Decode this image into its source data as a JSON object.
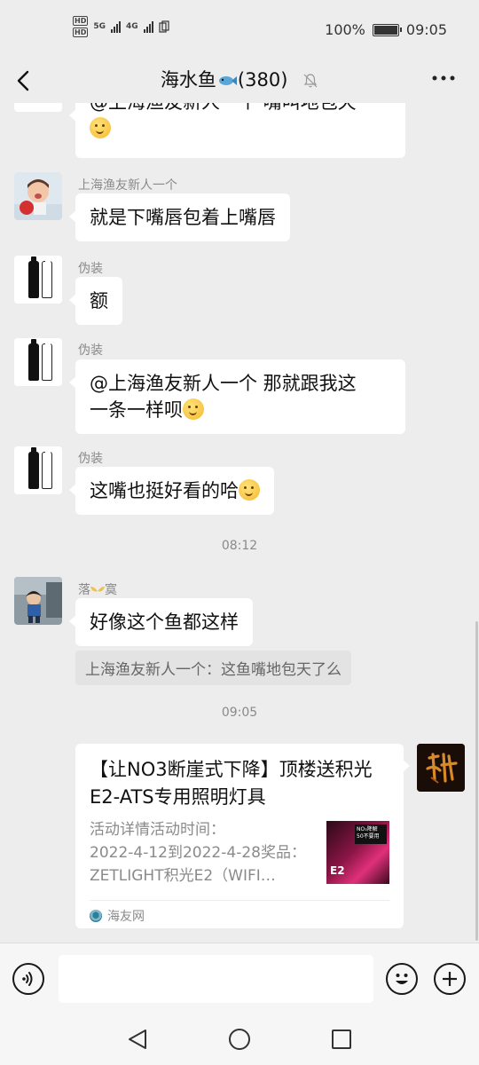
{
  "status_bar": {
    "network_left": "HD",
    "network_left_2": "HD",
    "signal_5g": "5G",
    "signal_4g": "4G",
    "battery_percent": "100%",
    "time": "09:05"
  },
  "header": {
    "title_prefix": "海水鱼",
    "title_count": "(380)",
    "back_icon": "chevron-left-icon",
    "mute_icon": "bell-off-icon",
    "more_icon": "more-icon"
  },
  "messages": [
    {
      "id": "m0",
      "sender": "",
      "text": "@上海渔友新人一个  嘴叫地包天",
      "partial": true
    },
    {
      "id": "m1",
      "sender": "上海渔友新人一个",
      "text": "就是下嘴唇包着上嘴唇"
    },
    {
      "id": "m2",
      "sender": "伪装",
      "text": "额"
    },
    {
      "id": "m3",
      "sender": "伪装",
      "text_line1": "@上海渔友新人一个  那就跟我这",
      "text_line2": "一条一样呗"
    },
    {
      "id": "m4",
      "sender": "伪装",
      "text": "这嘴也挺好看的哈"
    },
    {
      "id": "t1",
      "time": "08:12"
    },
    {
      "id": "m5",
      "sender_part1": "落",
      "sender_part2": "寞",
      "text": "好像这个鱼都这样",
      "quote": "上海渔友新人一个：这鱼嘴地包天了么"
    },
    {
      "id": "t2",
      "time": "09:05"
    }
  ],
  "link_card": {
    "title": "【让NO3断崖式下降】顶楼送积光E2-ATS专用照明灯具",
    "desc_line1": "活动详情活动时间：",
    "desc_line2": "2022-4-12到2022-4-28奖品：",
    "desc_line3": "ZETLIGHT积光E2（WIFI…",
    "thumb_badge_line1": "NO₃降解",
    "thumb_badge_line2": "50不要用",
    "thumb_label": "E2",
    "source": "海友网"
  },
  "input_bar": {
    "voice_icon": "voice-icon",
    "emoji_icon": "emoji-icon",
    "plus_icon": "plus-icon",
    "placeholder": ""
  },
  "nav_bar": {
    "back_icon": "triangle-back-icon",
    "home_icon": "circle-home-icon",
    "recents_icon": "square-recents-icon"
  }
}
